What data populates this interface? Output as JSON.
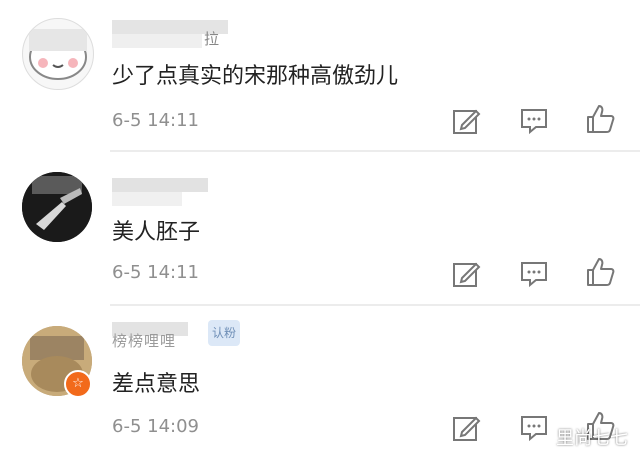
{
  "comments": [
    {
      "username_fragment": "拉",
      "text": "少了点真实的宋那种高傲劲儿",
      "time": "6-5 14:11"
    },
    {
      "username_fragment": "",
      "text": "美人胚子",
      "time": "6-5 14:11"
    },
    {
      "username_fragment": "榜榜哩哩",
      "badge": "认粉",
      "text": "差点意思",
      "time": "6-5 14:09"
    }
  ],
  "icons": [
    "edit-icon",
    "comment-icon",
    "like-icon"
  ],
  "watermark": "里尚七七"
}
